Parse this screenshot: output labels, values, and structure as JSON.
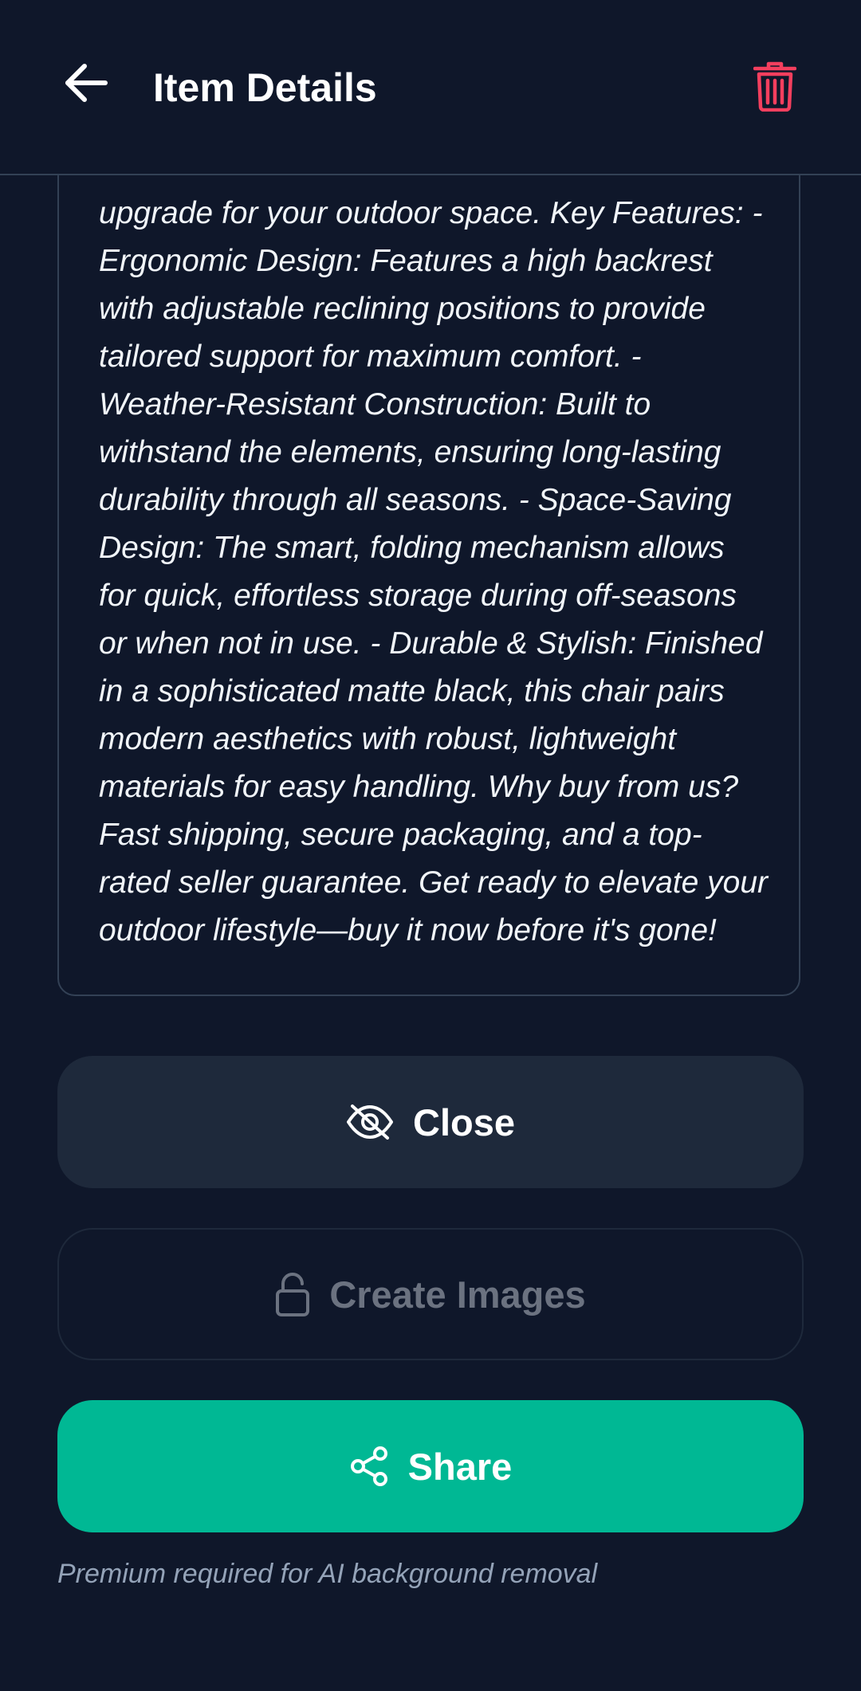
{
  "header": {
    "title": "Item Details",
    "back_icon": "arrow-left-icon",
    "delete_icon": "trash-icon",
    "delete_color": "#f43f5e"
  },
  "description": {
    "text": "upgrade for your outdoor space. Key Features: - Ergonomic Design: Features a high backrest with adjustable reclining positions to provide tailored support for maximum comfort. - Weather-Resistant Construction: Built to withstand the elements, ensuring long-lasting durability through all seasons. - Space-Saving Design: The smart, folding mechanism allows for quick, effortless storage during off-seasons or when not in use. - Durable & Stylish: Finished in a sophisticated matte black, this chair pairs modern aesthetics with robust, lightweight materials for easy handling. Why buy from us? Fast shipping, secure packaging, and a top-rated seller guarantee. Get ready to elevate your outdoor lifestyle—buy it now before it's gone!"
  },
  "actions": {
    "close_label": "Close",
    "close_icon": "eye-off-icon",
    "create_images_label": "Create Images",
    "create_images_icon": "lock-icon",
    "share_label": "Share",
    "share_icon": "share-icon"
  },
  "footer": {
    "note": "Premium required for AI background removal"
  },
  "colors": {
    "background": "#0f172a",
    "surface": "#1e293b",
    "accent": "#00b894",
    "danger": "#f43f5e",
    "muted": "#94a3b8"
  }
}
